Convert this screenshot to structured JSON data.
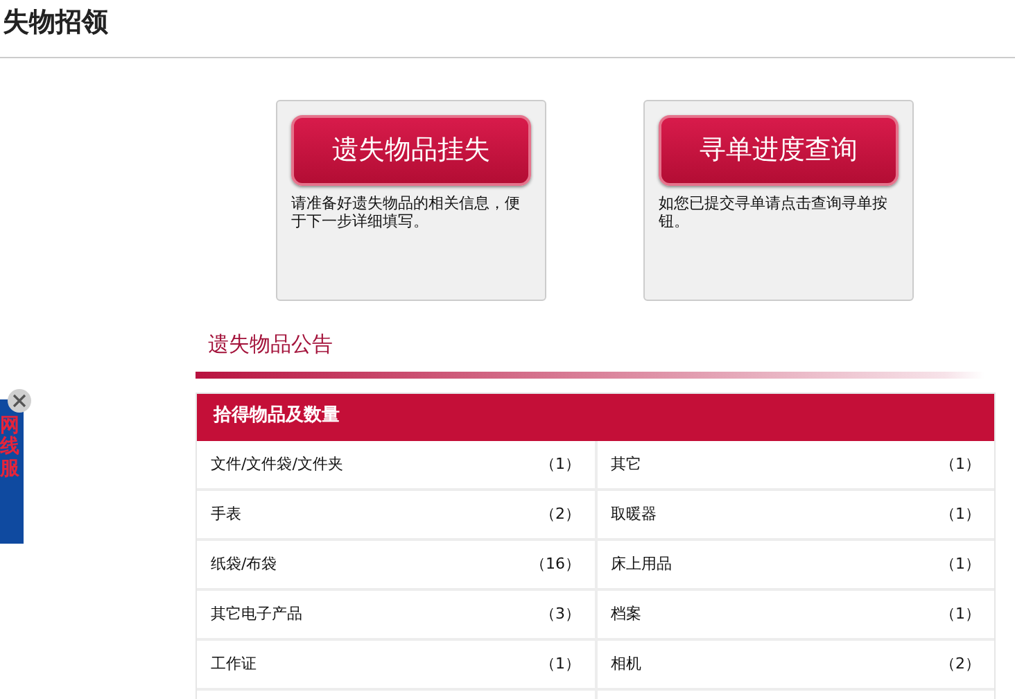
{
  "page_title": "失物招领",
  "actions": [
    {
      "button": "遗失物品挂失",
      "description": "请准备好遗失物品的相关信息，便于下一步详细填写。"
    },
    {
      "button": "寻单进度查询",
      "description": "如您已提交寻单请点击查询寻单按钮。"
    }
  ],
  "notice_heading": "遗失物品公告",
  "table": {
    "header": "拾得物品及数量",
    "rows": [
      [
        {
          "item": "文件/文件袋/文件夹",
          "count": "（1）"
        },
        {
          "item": "其它",
          "count": "（1）"
        }
      ],
      [
        {
          "item": "手表",
          "count": "（2）"
        },
        {
          "item": "取暖器",
          "count": "（1）"
        }
      ],
      [
        {
          "item": "纸袋/布袋",
          "count": "（16）"
        },
        {
          "item": "床上用品",
          "count": "（1）"
        }
      ],
      [
        {
          "item": "其它电子产品",
          "count": "（3）"
        },
        {
          "item": "档案",
          "count": "（1）"
        }
      ],
      [
        {
          "item": "工作证",
          "count": "（1）"
        },
        {
          "item": "相机",
          "count": "（2）"
        }
      ]
    ]
  },
  "side_ad": {
    "text": "网线服"
  }
}
